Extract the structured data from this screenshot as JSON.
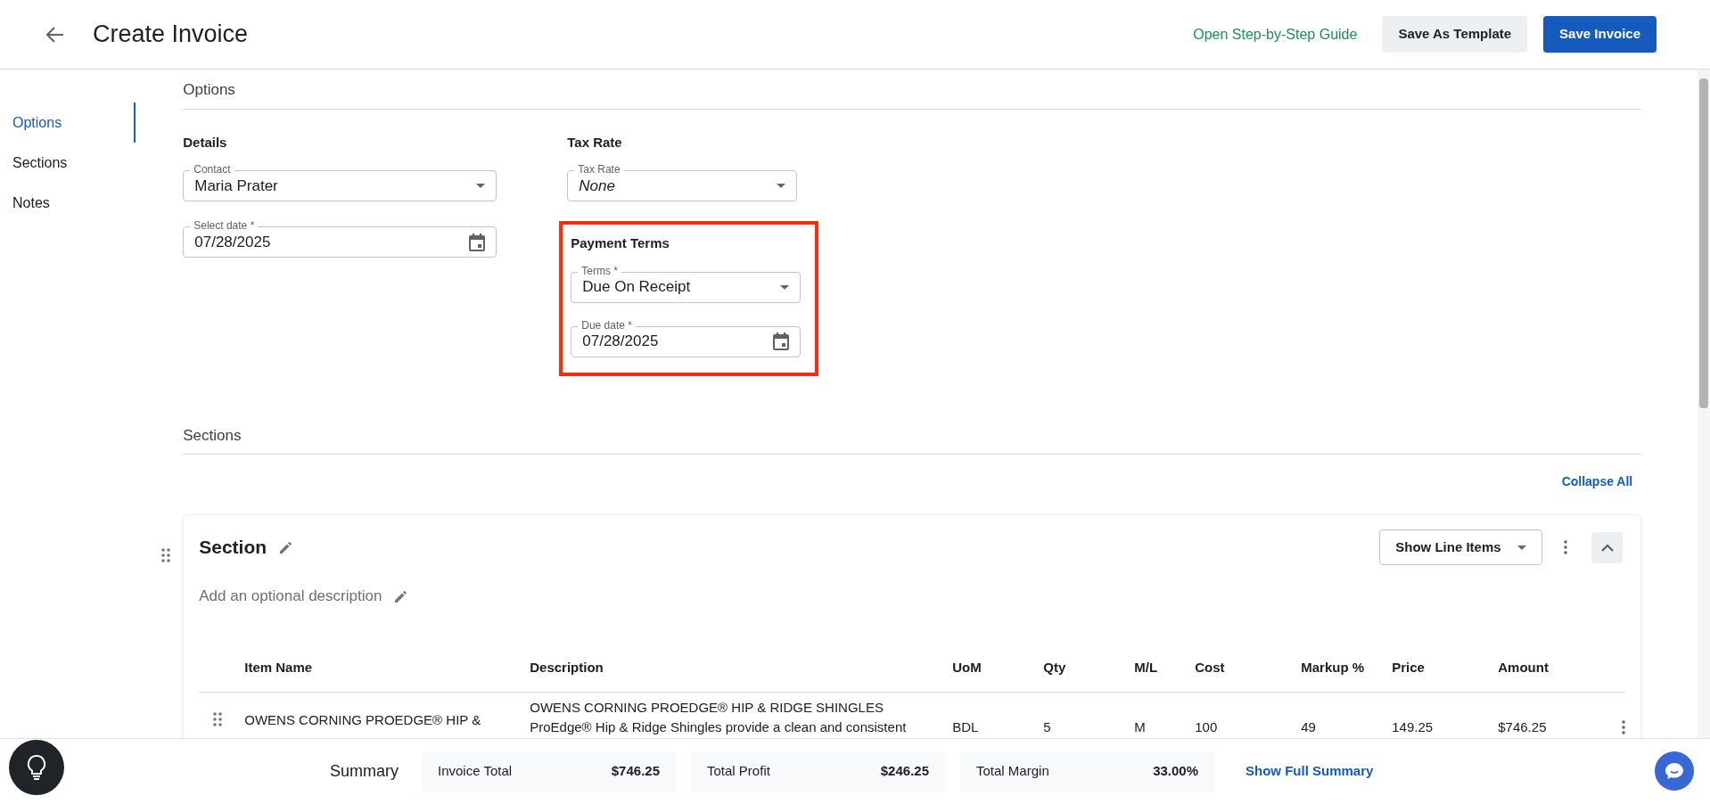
{
  "header": {
    "title": "Create Invoice",
    "guide_link": "Open Step-by-Step Guide",
    "buttons": [
      {
        "label": "Save As Template",
        "kind": "secondary"
      },
      {
        "label": "Save Invoice",
        "kind": "primary"
      }
    ]
  },
  "sidebar": {
    "items": [
      {
        "label": "Options",
        "selected": true
      },
      {
        "label": "Sections",
        "selected": false
      },
      {
        "label": "Notes",
        "selected": false
      }
    ]
  },
  "options": {
    "heading": "Options",
    "details": {
      "heading": "Details",
      "contact": {
        "label": "Contact",
        "value": "Maria Prater"
      },
      "date": {
        "label": "Select date *",
        "value": "07/28/2025"
      }
    },
    "tax_rate": {
      "heading": "Tax Rate",
      "field": {
        "label": "Tax Rate",
        "value": "None"
      }
    },
    "payment_terms": {
      "heading": "Payment Terms",
      "highlighted": true,
      "terms": {
        "label": "Terms *",
        "value": "Due On Receipt"
      },
      "due_date": {
        "label": "Due date *",
        "value": "07/28/2025"
      }
    }
  },
  "sections": {
    "heading": "Sections",
    "collapse_all": "Collapse All",
    "section": {
      "title": "Section",
      "description_placeholder": "Add an optional description",
      "show_menu": "Show Line Items",
      "table": {
        "columns": [
          "Item Name",
          "Description",
          "UoM",
          "Qty",
          "M/L",
          "Cost",
          "Markup %",
          "Price",
          "Amount"
        ],
        "rows": [
          {
            "item_name": "OWENS CORNING PROEDGE® HIP &",
            "description_lines": [
              "OWENS CORNING PROEDGE® HIP & RIDGE SHINGLES",
              "ProEdge® Hip & Ridge Shingles provide a clean and consistent"
            ],
            "uom": "BDL",
            "qty": "5",
            "ml": "M",
            "cost": "100",
            "markup": "49",
            "price": "149.25",
            "amount": "$746.25"
          }
        ]
      }
    }
  },
  "summary": {
    "label": "Summary",
    "cards": [
      {
        "label": "Invoice Total",
        "value": "$746.25"
      },
      {
        "label": "Total Profit",
        "value": "$246.25"
      },
      {
        "label": "Total Margin",
        "value": "33.00%"
      }
    ],
    "link": "Show Full Summary"
  }
}
